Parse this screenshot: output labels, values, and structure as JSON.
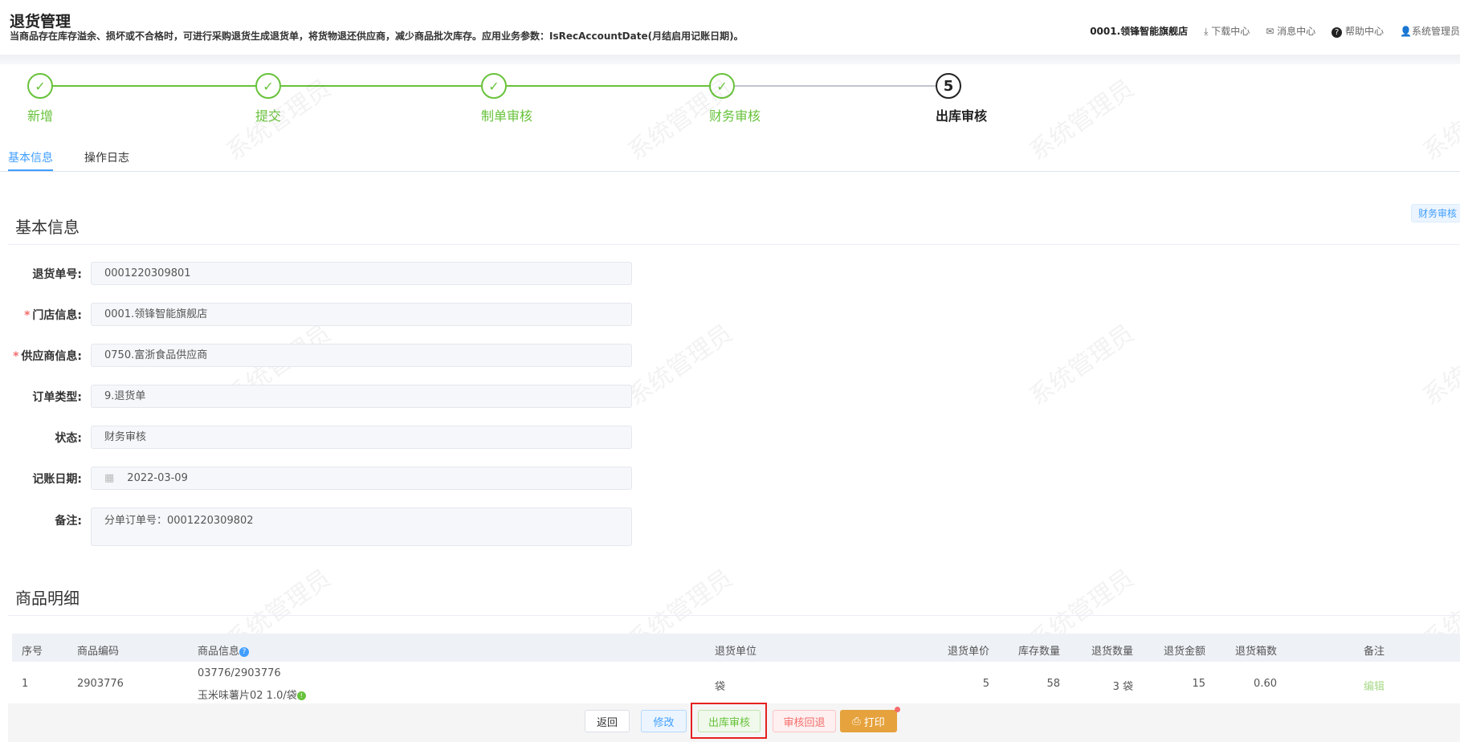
{
  "header": {
    "title": "退货管理",
    "description": "当商品存在库存溢余、损坏或不合格时，可进行采购退货生成退货单，将货物退还供应商，减少商品批次库存。应用业务参数：IsRecAccountDate(月结启用记账日期)。",
    "store": "0001.领锋智能旗舰店",
    "download": "下载中心",
    "messages": "消息中心",
    "help": "帮助中心",
    "user": "系统管理员"
  },
  "steps": [
    {
      "label": "新增",
      "status": "done"
    },
    {
      "label": "提交",
      "status": "done"
    },
    {
      "label": "制单审核",
      "status": "done"
    },
    {
      "label": "财务审核",
      "status": "done"
    },
    {
      "label": "出库审核",
      "number": "5",
      "status": "current"
    }
  ],
  "tabs": [
    {
      "label": "基本信息",
      "active": true
    },
    {
      "label": "操作日志",
      "active": false
    }
  ],
  "basic": {
    "heading": "基本信息",
    "status_badge": "财务审核",
    "fields": [
      {
        "label": "退货单号:",
        "value": "0001220309801",
        "required": false
      },
      {
        "label": "门店信息:",
        "value": "0001.领锋智能旗舰店",
        "required": true
      },
      {
        "label": "供应商信息:",
        "value": "0750.富浙食品供应商",
        "required": true
      },
      {
        "label": "订单类型:",
        "value": "9.退货单",
        "required": false
      },
      {
        "label": "状态:",
        "value": "财务审核",
        "required": false
      },
      {
        "label": "记账日期:",
        "value": "2022-03-09",
        "required": false
      },
      {
        "label": "备注:",
        "value": "分单订单号：0001220309802",
        "required": false
      }
    ]
  },
  "details": {
    "heading": "商品明细",
    "columns": [
      "序号",
      "商品编码",
      "商品信息",
      "退货单位",
      "退货单价",
      "库存数量",
      "退货数量",
      "退货金额",
      "退货箱数",
      "备注"
    ],
    "rows": [
      {
        "index": "1",
        "code": "2903776",
        "info_line1": "03776/2903776",
        "info_line2": "玉米味薯片02 1.0/袋",
        "unit": "袋",
        "price": "5",
        "stock": "58",
        "qty": "3 袋",
        "amount": "15",
        "boxes": "0.60",
        "remark": "编辑"
      }
    ]
  },
  "footer": {
    "back": "返回",
    "edit": "修改",
    "outbound_audit": "出库审核",
    "audit_reject": "审核回退",
    "print": "打印"
  },
  "watermark": "系统管理员",
  "colors": {
    "success": "#67c23a",
    "primary": "#409eff",
    "danger": "#f56c6c",
    "warning": "#e6a23c",
    "highlight": "#e62020"
  }
}
